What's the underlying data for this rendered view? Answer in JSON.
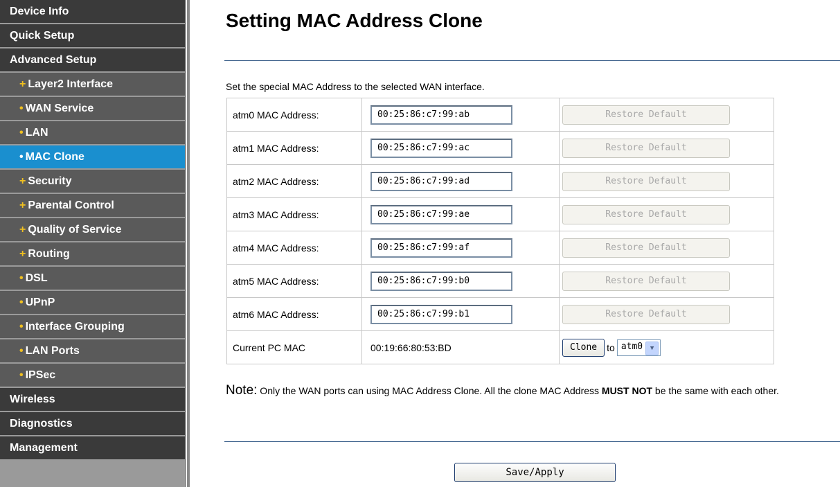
{
  "sidebar": {
    "items": [
      {
        "label": "Device Info",
        "level": 0
      },
      {
        "label": "Quick Setup",
        "level": 0
      },
      {
        "label": "Advanced Setup",
        "level": 0
      },
      {
        "label": "Layer2 Interface",
        "level": 1,
        "bullet": "+"
      },
      {
        "label": "WAN Service",
        "level": 1,
        "bullet": "•"
      },
      {
        "label": "LAN",
        "level": 1,
        "bullet": "•"
      },
      {
        "label": "MAC Clone",
        "level": 1,
        "bullet": "•",
        "active": true
      },
      {
        "label": "Security",
        "level": 1,
        "bullet": "+"
      },
      {
        "label": "Parental Control",
        "level": 1,
        "bullet": "+"
      },
      {
        "label": "Quality of Service",
        "level": 1,
        "bullet": "+"
      },
      {
        "label": "Routing",
        "level": 1,
        "bullet": "+"
      },
      {
        "label": "DSL",
        "level": 1,
        "bullet": "•"
      },
      {
        "label": "UPnP",
        "level": 1,
        "bullet": "•"
      },
      {
        "label": "Interface Grouping",
        "level": 1,
        "bullet": "•"
      },
      {
        "label": "LAN Ports",
        "level": 1,
        "bullet": "•"
      },
      {
        "label": "IPSec",
        "level": 1,
        "bullet": "•"
      },
      {
        "label": "Wireless",
        "level": 0
      },
      {
        "label": "Diagnostics",
        "level": 0
      },
      {
        "label": "Management",
        "level": 0
      }
    ]
  },
  "main": {
    "title": "Setting MAC Address Clone",
    "intro": "Set the special MAC Address to the selected WAN interface.",
    "rows": [
      {
        "label": "atm0 MAC Address:",
        "value": "00:25:86:c7:99:ab",
        "button": "Restore Default"
      },
      {
        "label": "atm1 MAC Address:",
        "value": "00:25:86:c7:99:ac",
        "button": "Restore Default"
      },
      {
        "label": "atm2 MAC Address:",
        "value": "00:25:86:c7:99:ad",
        "button": "Restore Default"
      },
      {
        "label": "atm3 MAC Address:",
        "value": "00:25:86:c7:99:ae",
        "button": "Restore Default"
      },
      {
        "label": "atm4 MAC Address:",
        "value": "00:25:86:c7:99:af",
        "button": "Restore Default"
      },
      {
        "label": "atm5 MAC Address:",
        "value": "00:25:86:c7:99:b0",
        "button": "Restore Default"
      },
      {
        "label": "atm6 MAC Address:",
        "value": "00:25:86:c7:99:b1",
        "button": "Restore Default"
      }
    ],
    "current_pc": {
      "label": "Current PC MAC",
      "value": "00:19:66:80:53:BD",
      "clone_label": "Clone",
      "to_text": "to",
      "selected_interface": "atm0"
    },
    "note": {
      "label": "Note:",
      "text_before": " Only the WAN ports can using MAC Address Clone. All the clone MAC Address ",
      "strong": "MUST NOT",
      "text_after": " be the same with each other."
    },
    "save_label": "Save/Apply"
  },
  "colors": {
    "sidebar_item_bg": "#3a3a3a",
    "sidebar_sub_bg": "#5a5a5a",
    "sidebar_active_bg": "#1a8fcf",
    "sidebar_bullet": "#f0c020",
    "rule_line": "#3b5f8a"
  }
}
